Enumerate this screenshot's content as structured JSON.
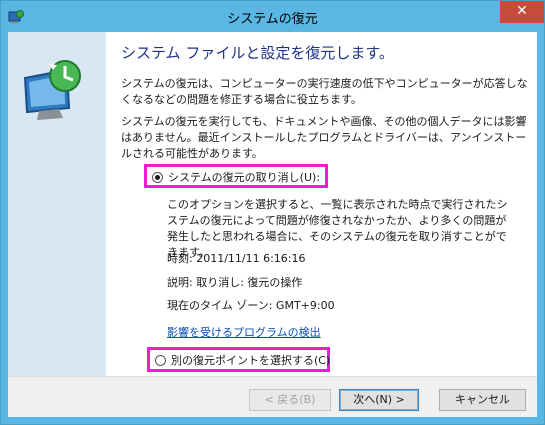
{
  "window": {
    "title": "システムの復元",
    "close_label": "✕"
  },
  "main": {
    "heading": "システム ファイルと設定を復元します。",
    "paragraph1": "システムの復元は、コンピューターの実行速度の低下やコンピューターが応答しなくなるなどの問題を修正する場合に役立ちます。",
    "paragraph2": "システムの復元を実行しても、ドキュメントや画像、その他の個人データには影響はありません。最近インストールしたプログラムとドライバーは、アンインストールされる可能性があります。",
    "option_undo": {
      "label": "システムの復元の取り消し(U):",
      "checked": true
    },
    "option_desc": "このオプションを選択すると、一覧に表示された時点で実行されたシステムの復元によって問題が修復されなかったか、より多くの問題が発生したと思われる場合に、そのシステムの復元を取り消すことができます。",
    "time_text": "時刻: 2011/11/11 6:16:16",
    "description_text": "説明: 取り消し: 復元の操作",
    "timezone_text": "現在のタイム ゾーン: GMT+9:00",
    "scan_link": "影響を受けるプログラムの検出",
    "option_choose": {
      "label": "別の復元ポイントを選択する(C)",
      "checked": false
    }
  },
  "footer": {
    "back_label": "< 戻る(B)",
    "next_label": "次へ(N) >",
    "cancel_label": "キャンセル"
  },
  "colors": {
    "title_bar": "#5ab7e3",
    "close_button": "#c74c3c",
    "side_panel": "#d9e6f4",
    "heading": "#1e3287",
    "highlight": "#ef1bd7",
    "link": "#0a4fb3"
  },
  "icons": {
    "app": "system-restore-icon",
    "hero": "system-restore-monitor-icon"
  }
}
